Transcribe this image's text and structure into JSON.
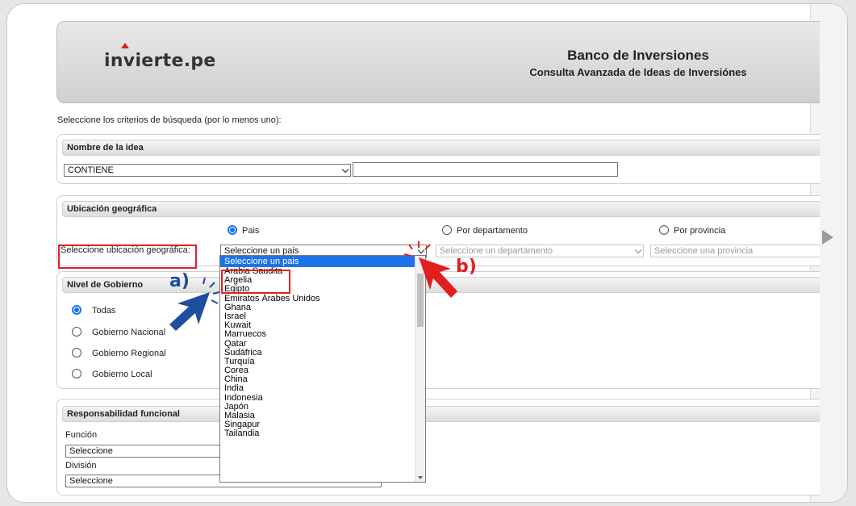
{
  "banner": {
    "logo_text": "invierte.pe",
    "title": "Banco de Inversiones",
    "subtitle": "Consulta Avanzada de Ideas de Inversiónes"
  },
  "criteria_text": "Seleccione los criterios de búsqueda (por lo menos uno):",
  "nombre": {
    "legend": "Nombre de la idea",
    "operator_value": "CONTIENE",
    "text_value": ""
  },
  "ubicacion": {
    "legend": "Ubicación geográfica",
    "radio_pais": "Pais",
    "radio_departamento": "Por departamento",
    "radio_provincia": "Por provincia",
    "select_label": "Seleccione ubicación geográfica:",
    "pais_value": "Seleccione un pais",
    "departamento_placeholder": "Seleccione un departamento",
    "provincia_placeholder": "Seleccione una provincia",
    "pais_options": [
      "Seleccione un pais",
      "Arabia Saudita",
      "Argelia",
      "Egipto",
      "Emiratos Árabes Unidos",
      "Ghana",
      "Israel",
      "Kuwait",
      "Marruecos",
      "Qatar",
      "Sudáfrica",
      "Turquía",
      "Corea",
      "China",
      "India",
      "Indonesia",
      "Japón",
      "Malasia",
      "Singapur",
      "Tailandia"
    ]
  },
  "gobierno": {
    "legend": "Nivel de Gobierno",
    "opt_todas": "Todas",
    "opt_nacional": "Gobierno Nacional",
    "opt_regional": "Gobierno Regional",
    "opt_local": "Gobierno Local"
  },
  "responsabilidad": {
    "legend": "Responsabilidad funcional",
    "funcion_label": "Función",
    "funcion_value": "Seleccione",
    "division_label": "División",
    "division_value": "Seleccione"
  },
  "annotations": {
    "a_label": "a)",
    "b_label": "b)",
    "a_color": "#1f4e9c",
    "b_color": "#e02020"
  }
}
